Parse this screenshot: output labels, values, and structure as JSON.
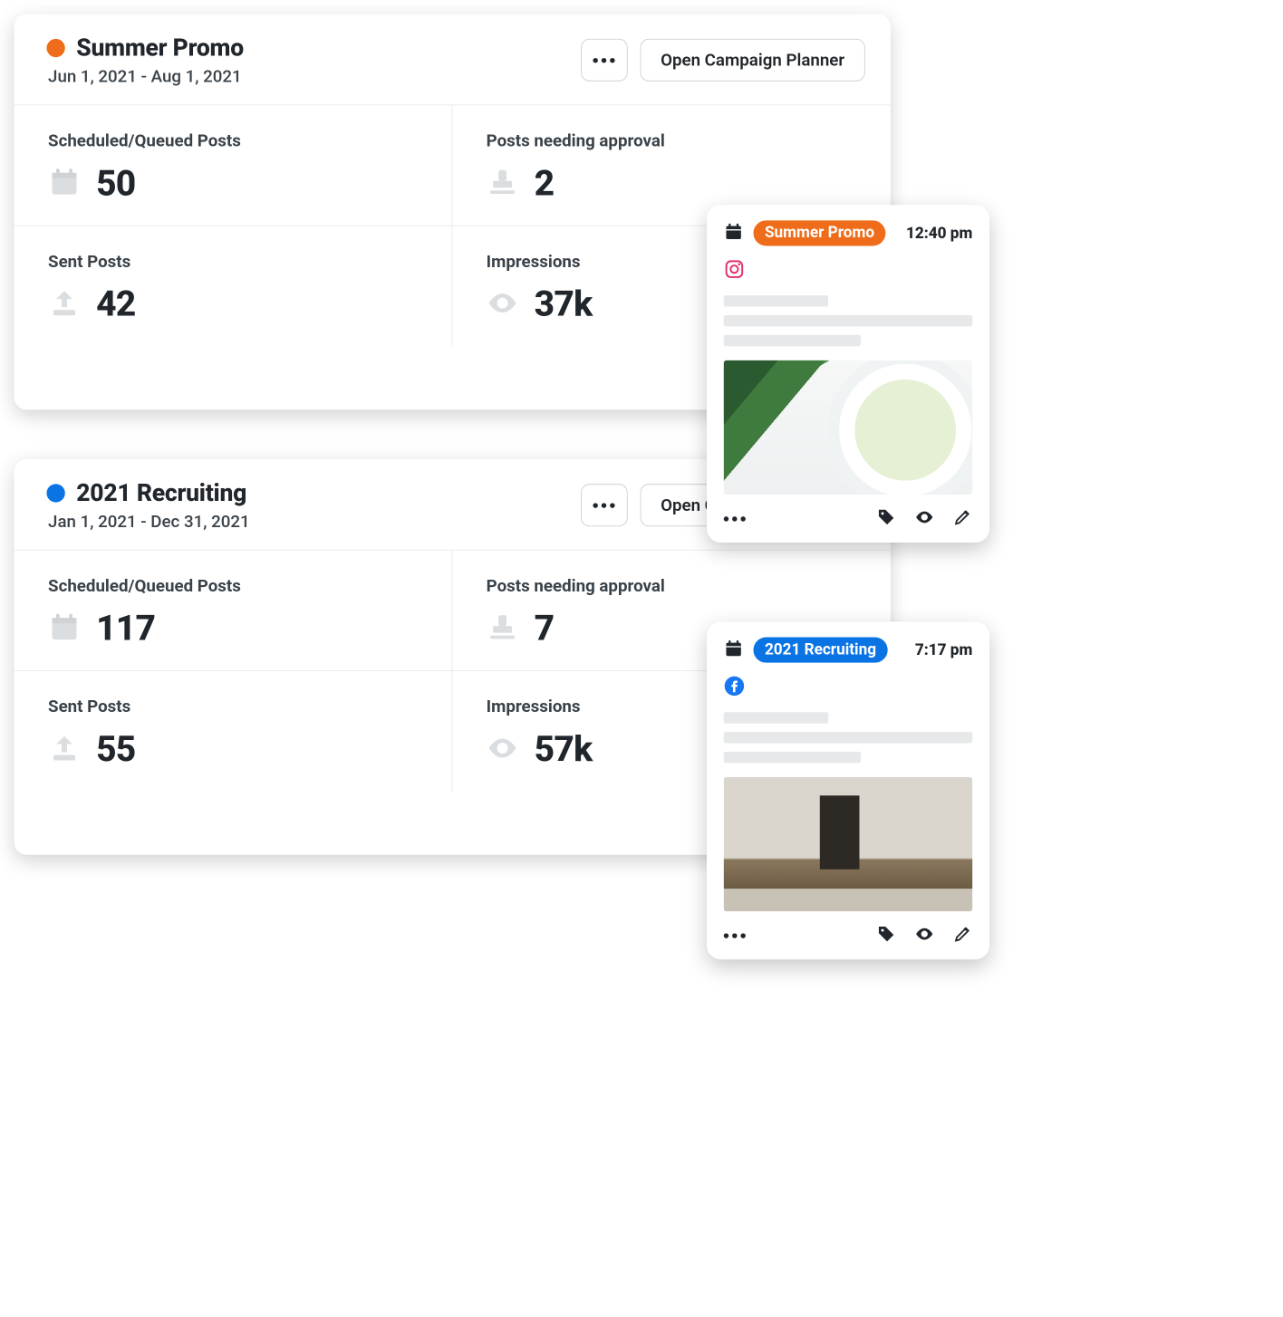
{
  "campaigns": [
    {
      "color": "orange",
      "title": "Summer Promo",
      "date_range": "Jun 1, 2021 - Aug 1, 2021",
      "open_button": "Open Campaign Planner",
      "stats": {
        "scheduled_label": "Scheduled/Queued Posts",
        "scheduled_value": "50",
        "approval_label": "Posts needing approval",
        "approval_value": "2",
        "sent_label": "Sent Posts",
        "sent_value": "42",
        "impressions_label": "Impressions",
        "impressions_value": "37k"
      }
    },
    {
      "color": "blue",
      "title": "2021 Recruiting",
      "date_range": "Jan 1, 2021 - Dec 31, 2021",
      "open_button": "Open Campaign Planner",
      "stats": {
        "scheduled_label": "Scheduled/Queued Posts",
        "scheduled_value": "117",
        "approval_label": "Posts needing approval",
        "approval_value": "7",
        "sent_label": "Sent Posts",
        "sent_value": "55",
        "impressions_label": "Impressions",
        "impressions_value": "57k"
      }
    }
  ],
  "posts": [
    {
      "tag_color": "orange",
      "tag_label": "Summer Promo",
      "time": "12:40 pm",
      "network": "instagram"
    },
    {
      "tag_color": "blue",
      "tag_label": "2021 Recruiting",
      "time": "7:17 pm",
      "network": "facebook"
    }
  ]
}
